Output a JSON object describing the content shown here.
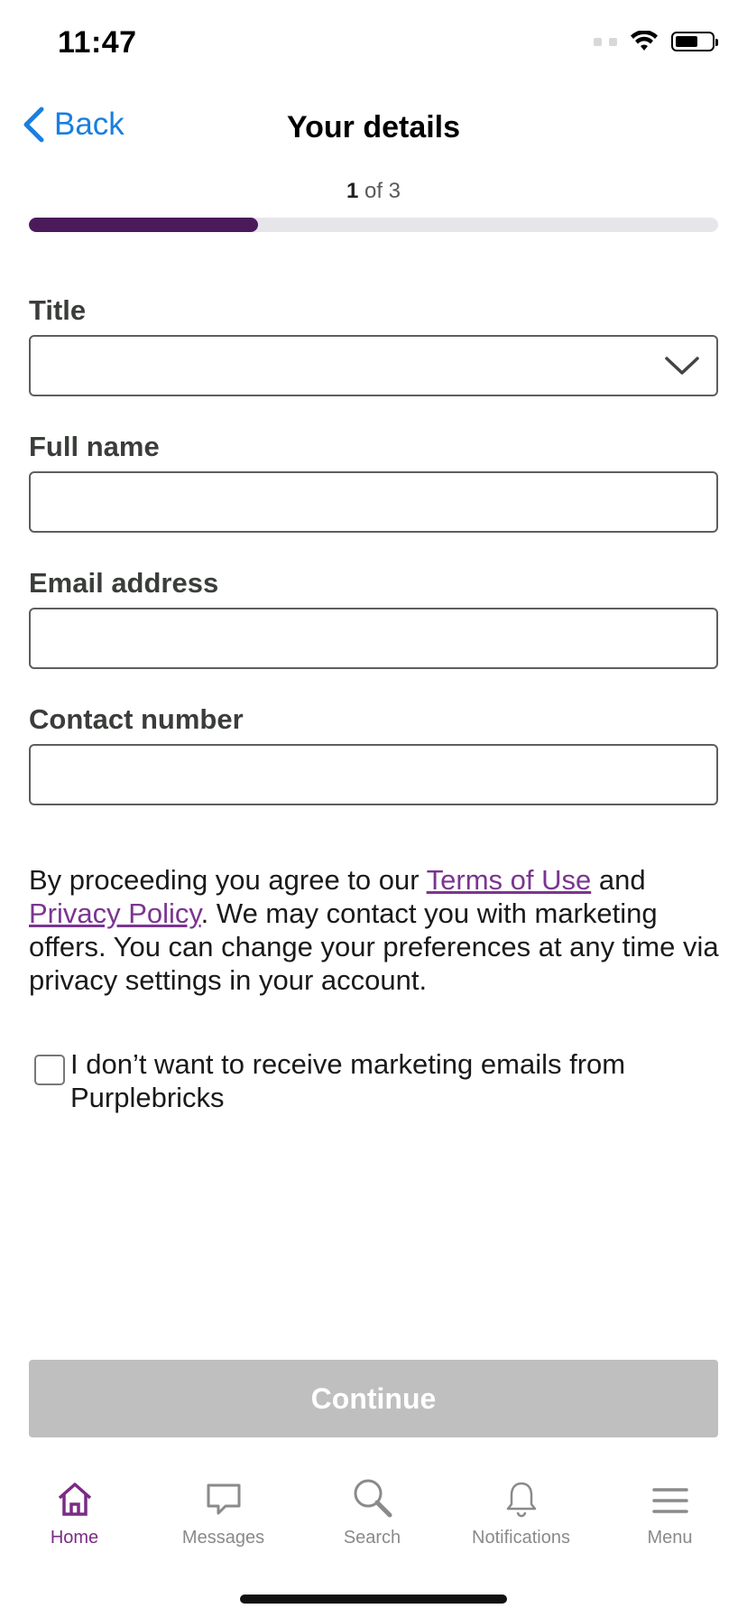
{
  "status_bar": {
    "time": "11:47"
  },
  "nav": {
    "back_label": "Back",
    "title": "Your details"
  },
  "steps": {
    "current": "1",
    "of_text": " of 3",
    "progress": 0.333
  },
  "form": {
    "title_label": "Title",
    "title_value": "",
    "full_name_label": "Full name",
    "email_label": "Email address",
    "contact_label": "Contact number"
  },
  "legal": {
    "prefix": "By proceeding you agree to our ",
    "terms_link": "Terms of Use",
    "and_text": " and ",
    "privacy_link": "Privacy Policy",
    "suffix": ". We may contact you with marketing offers. You can change your preferences at any time via privacy settings in your account."
  },
  "marketing_opt_out": {
    "label": "I don’t want to receive marketing emails from Purplebricks",
    "checked": false
  },
  "continue_label": "Continue",
  "tabbar": {
    "home": "Home",
    "messages": "Messages",
    "search": "Search",
    "notifications": "Notifications",
    "menu": "Menu"
  },
  "colors": {
    "accent": "#7b2b84",
    "progress_fill": "#4b1a5a",
    "link": "#1a7fe0",
    "disabled_button": "#bfbfbf"
  }
}
